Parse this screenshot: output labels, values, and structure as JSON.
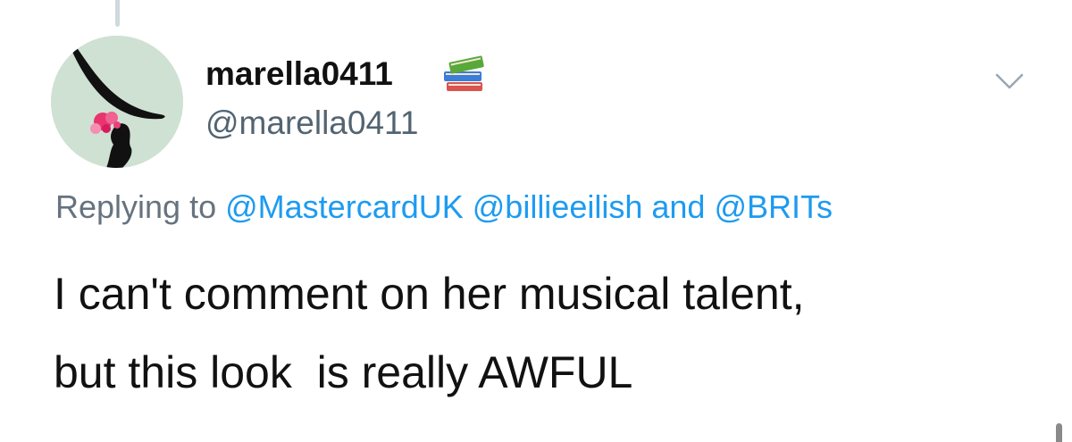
{
  "tweet": {
    "display_name": "marella0411",
    "name_emoji": "books-icon",
    "handle": "@marella0411",
    "reply": {
      "prefix": "Replying to",
      "mention_1": "@MastercardUK",
      "mention_2": "@billieeilish",
      "conjunction": "and",
      "mention_3": "@BRITs"
    },
    "text_lines": [
      "I can't comment on her musical talent,",
      "but this look  is really AWFUL"
    ]
  },
  "icons": {
    "avatar": "avatar-hat-silhouette",
    "menu": "chevron-down-icon"
  },
  "colors": {
    "mention": "#1d9bf0",
    "secondary_text": "#536471",
    "primary_text": "#111111",
    "avatar_bg": "#cfe1d3"
  }
}
